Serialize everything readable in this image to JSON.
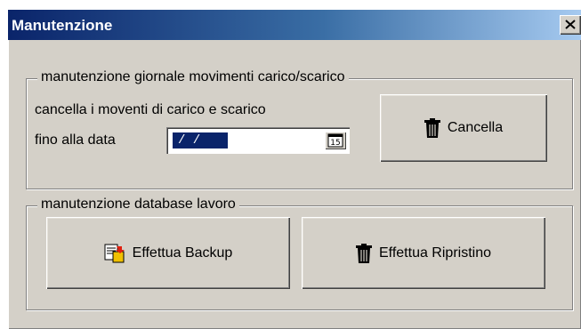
{
  "window": {
    "title": "Manutenzione",
    "close_glyph": "X"
  },
  "group_movimenti": {
    "legend": "manutenzione giornale movimenti carico/scarico",
    "description": "cancella i moventi di carico e scarico",
    "date_label": "fino alla data",
    "date_value": "/ /",
    "calendar_icon": "calendar-icon",
    "cancella_label": "Cancella",
    "cancella_icon": "trash-icon"
  },
  "group_database": {
    "legend": "manutenzione database lavoro",
    "backup_label": "Effettua Backup",
    "backup_icon": "backup-icon",
    "ripristino_label": "Effettua Ripristino",
    "ripristino_icon": "trash-icon"
  },
  "colors": {
    "titlebar_start": "#0a246a",
    "titlebar_end": "#a6caf0",
    "face": "#d4d0c8",
    "selection": "#0a246a"
  }
}
